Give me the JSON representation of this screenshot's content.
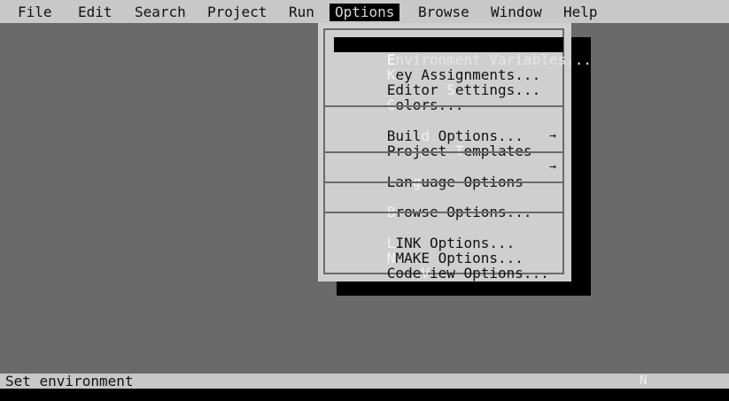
{
  "menubar": {
    "items": [
      {
        "label": "File"
      },
      {
        "label": "Edit"
      },
      {
        "label": "Search"
      },
      {
        "label": "Project"
      },
      {
        "label": "Run"
      },
      {
        "label": "Options",
        "active": true
      },
      {
        "label": "Browse"
      },
      {
        "label": "Window"
      },
      {
        "label": "Help"
      }
    ]
  },
  "options_menu": {
    "items": [
      {
        "hotkey": "E",
        "rest": "nvironment Variables...",
        "selected": true
      },
      {
        "hotkey": "K",
        "rest": "ey Assignments..."
      },
      {
        "pre": "Editor ",
        "hotkey": "S",
        "rest": "ettings..."
      },
      {
        "hotkey": "C",
        "rest": "olors..."
      },
      {
        "pre": "Buil",
        "hotkey": "d",
        "rest": " Options..."
      },
      {
        "pre": "Project ",
        "hotkey": "T",
        "rest": "emplates",
        "arrow": "→"
      },
      {
        "pre": "Lan",
        "hotkey": "g",
        "rest": "uage Options",
        "arrow": "→"
      },
      {
        "hotkey": "B",
        "rest": "rowse Options..."
      },
      {
        "hotkey": "L",
        "rest": "INK Options..."
      },
      {
        "hotkey": "N",
        "rest": "MAKE Options..."
      },
      {
        "pre": "Code",
        "hotkey": "V",
        "rest": "iew Options..."
      }
    ]
  },
  "statusbar": {
    "message": "Set environment",
    "indicator": "N"
  }
}
